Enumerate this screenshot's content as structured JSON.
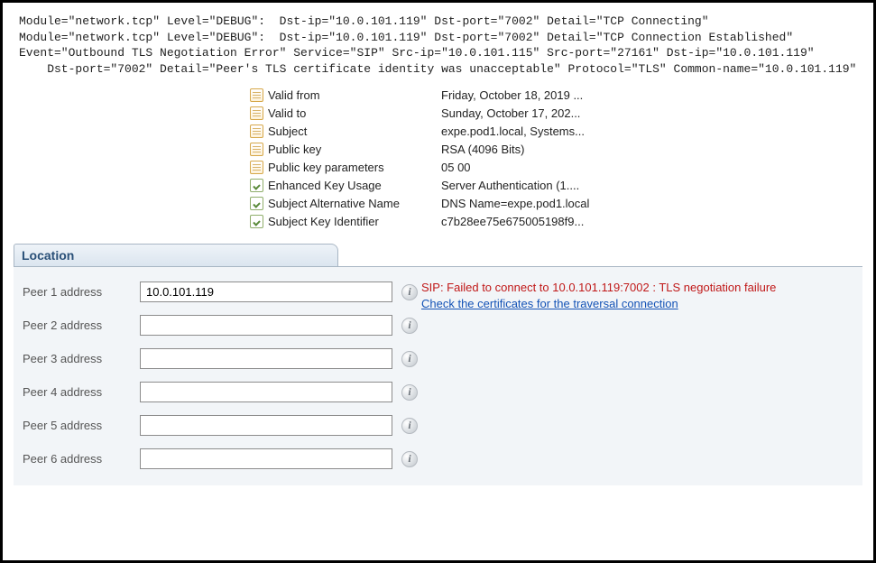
{
  "logs": {
    "line1": "Module=\"network.tcp\" Level=\"DEBUG\":  Dst-ip=\"10.0.101.119\" Dst-port=\"7002\" Detail=\"TCP Connecting\"",
    "line2": "Module=\"network.tcp\" Level=\"DEBUG\":  Dst-ip=\"10.0.101.119\" Dst-port=\"7002\" Detail=\"TCP Connection Established\"",
    "line3": "Event=\"Outbound TLS Negotiation Error\" Service=\"SIP\" Src-ip=\"10.0.101.115\" Src-port=\"27161\" Dst-ip=\"10.0.101.119\"",
    "line4": "    Dst-port=\"7002\" Detail=\"Peer's TLS certificate identity was unacceptable\" Protocol=\"TLS\" Common-name=\"10.0.101.119\""
  },
  "cert": {
    "rows": [
      {
        "icon": "doc",
        "label": "Valid from",
        "value": "Friday, October 18, 2019 ..."
      },
      {
        "icon": "doc",
        "label": "Valid to",
        "value": "Sunday, October 17, 202..."
      },
      {
        "icon": "doc",
        "label": "Subject",
        "value": "expe.pod1.local, Systems..."
      },
      {
        "icon": "doc",
        "label": "Public key",
        "value": "RSA (4096 Bits)"
      },
      {
        "icon": "doc",
        "label": "Public key parameters",
        "value": "05 00"
      },
      {
        "icon": "ext",
        "label": "Enhanced Key Usage",
        "value": "Server Authentication (1...."
      },
      {
        "icon": "ext",
        "label": "Subject Alternative Name",
        "value": "DNS Name=expe.pod1.local"
      },
      {
        "icon": "ext",
        "label": "Subject Key Identifier",
        "value": "c7b28ee75e675005198f9..."
      }
    ]
  },
  "location": {
    "title": "Location",
    "error_text": "SIP: Failed to connect to 10.0.101.119:7002 : TLS negotiation failure",
    "error_link": "Check the certificates for the traversal connection",
    "peers": [
      {
        "label": "Peer 1 address",
        "value": "10.0.101.119"
      },
      {
        "label": "Peer 2 address",
        "value": ""
      },
      {
        "label": "Peer 3 address",
        "value": ""
      },
      {
        "label": "Peer 4 address",
        "value": ""
      },
      {
        "label": "Peer 5 address",
        "value": ""
      },
      {
        "label": "Peer 6 address",
        "value": ""
      }
    ]
  }
}
